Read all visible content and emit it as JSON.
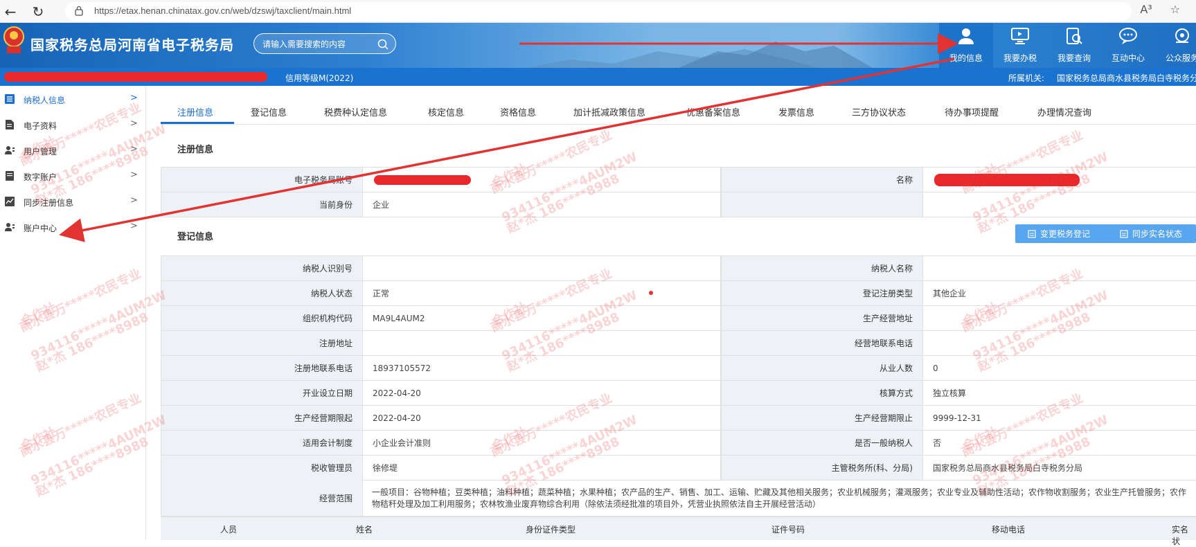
{
  "browser": {
    "url": "https://etax.henan.chinatax.gov.cn/web/dzswj/taxclient/main.html",
    "reader_icon": "A³",
    "favorite_icon": "☆"
  },
  "header": {
    "title": "国家税务总局河南省电子税务局",
    "search_placeholder": "请输入需要搜索的内容",
    "nav": [
      {
        "label": "我的信息",
        "icon": "user-icon"
      },
      {
        "label": "我要办税",
        "icon": "monitor-icon"
      },
      {
        "label": "我要查询",
        "icon": "document-search-icon"
      },
      {
        "label": "互动中心",
        "icon": "chat-icon"
      },
      {
        "label": "公众服务",
        "icon": "service-icon"
      }
    ]
  },
  "info_bar": {
    "credit": "信用等级M(2022)",
    "authority_label": "所属机关:",
    "authority": "国家税务总局商水县税务局白寺税务分"
  },
  "sidebar": {
    "items": [
      {
        "label": "纳税人信息",
        "icon": "list-icon"
      },
      {
        "label": "电子资料",
        "icon": "file-icon"
      },
      {
        "label": "用户管理",
        "icon": "user-manage-icon"
      },
      {
        "label": "数字账户",
        "icon": "book-icon"
      },
      {
        "label": "同步注册信息",
        "icon": "chart-line-icon"
      },
      {
        "label": "账户中心",
        "icon": "account-icon"
      }
    ],
    "arrow": ">"
  },
  "tabs": [
    "注册信息",
    "登记信息",
    "税费种认定信息",
    "核定信息",
    "资格信息",
    "加计抵减政策信息",
    "优惠备案信息",
    "发票信息",
    "三方协议状态",
    "待办事项提醒",
    "办理情况查询"
  ],
  "registration": {
    "title": "注册信息",
    "rows": [
      {
        "label_left": "电子税务局账号",
        "value_left": "",
        "label_right": "名称",
        "value_right": ""
      },
      {
        "label_left": "当前身份",
        "value_left": "企业",
        "label_right": "",
        "value_right": ""
      }
    ]
  },
  "registration_detail": {
    "title": "登记信息",
    "buttons": {
      "change": "变更税务登记",
      "sync": "同步实名状态"
    },
    "rows": [
      {
        "label_left": "纳税人识别号",
        "value_left": "",
        "label_right": "纳税人名称",
        "value_right": ""
      },
      {
        "label_left": "纳税人状态",
        "value_left": "正常",
        "label_right": "登记注册类型",
        "value_right": "其他企业"
      },
      {
        "label_left": "组织机构代码",
        "value_left": "MA9L4AUM2",
        "label_right": "生产经营地址",
        "value_right": ""
      },
      {
        "label_left": "注册地址",
        "value_left": "",
        "label_right": "经营地联系电话",
        "value_right": ""
      },
      {
        "label_left": "注册地联系电话",
        "value_left": "18937105572",
        "label_right": "从业人数",
        "value_right": "0"
      },
      {
        "label_left": "开业设立日期",
        "value_left": "2022-04-20",
        "label_right": "核算方式",
        "value_right": "独立核算"
      },
      {
        "label_left": "生产经营期限起",
        "value_left": "2022-04-20",
        "label_right": "生产经营期限止",
        "value_right": "9999-12-31"
      },
      {
        "label_left": "适用会计制度",
        "value_left": "小企业会计准则",
        "label_right": "是否一般纳税人",
        "value_right": "否"
      },
      {
        "label_left": "税收管理员",
        "value_left": "徐修堤",
        "label_right": "主管税务所(科、分局)",
        "value_right": "国家税务总局商水县税务局白寺税务分局"
      }
    ],
    "scope_label": "经营范围",
    "scope_text": "一般项目：谷物种植；豆类种植；油料种植；蔬菜种植；水果种植；农产品的生产、销售、加工、运输、贮藏及其他相关服务；农业机械服务；灌溉服务；农业专业及辅助性活动；农作物收割服务；农业生产托管服务；农作物秸秆处理及加工利用服务；农林牧渔业废弃物综合利用（除依法须经批准的项目外，凭营业执照依法自主开展经营活动）"
  },
  "people_table": {
    "headers": [
      "人员",
      "姓名",
      "身份证件类型",
      "证件号码",
      "移动电话",
      "实名状"
    ]
  },
  "watermark": {
    "line1": "商水县万*****农民专业",
    "line2": "合作社",
    "line3": "934116*****4AUM2W",
    "line4": "赵*杰 186****8988"
  },
  "colors": {
    "accent": "#1a6ed0",
    "redaction": "#e8282b",
    "arrow": "#e23333"
  }
}
